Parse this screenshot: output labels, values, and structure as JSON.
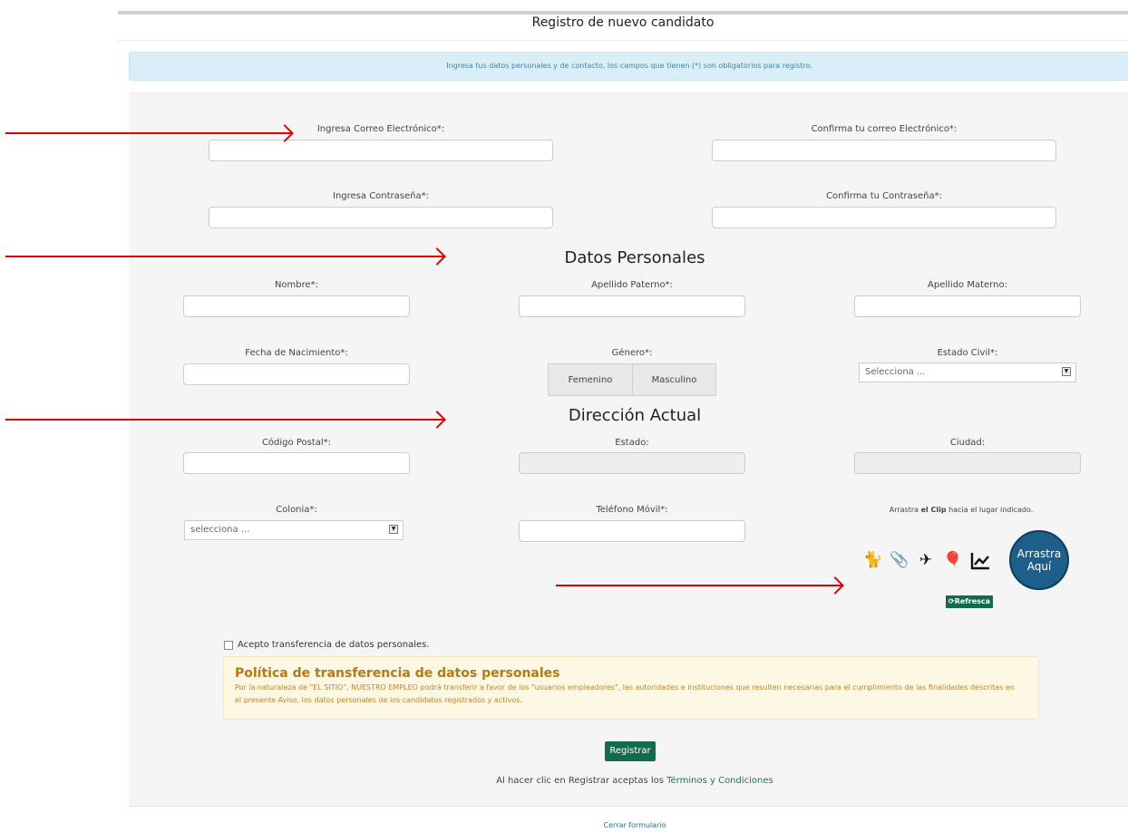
{
  "header": {
    "title": "Registro de nuevo candidato"
  },
  "notice": {
    "text": "Ingresa tus datos personales y de contacto, los campos que tienen (*) son obligatorios para registro."
  },
  "account": {
    "email_label": "Ingresa Correo Electrónico*:",
    "email_confirm_label": "Confirma tu correo Electrónico*:",
    "password_label": "Ingresa Contraseña*:",
    "password_confirm_label": "Confirma tu Contraseña*:"
  },
  "personal": {
    "heading": "Datos Personales",
    "nombre_label": "Nombre*:",
    "apellido_paterno_label": "Apellido Paterno*:",
    "apellido_materno_label": "Apellido Materno:",
    "fecha_label": "Fecha de Nacimiento*:",
    "genero_label": "Género*:",
    "genero_options": [
      "Femenino",
      "Masculino"
    ],
    "estado_civil_label": "Estado Civil*:",
    "estado_civil_value": "Selecciona ..."
  },
  "address": {
    "heading": "Dirección Actual",
    "cp_label": "Código Postal*:",
    "estado_label": "Estado:",
    "ciudad_label": "Ciudad:",
    "colonia_label": "Colonia*:",
    "colonia_value": "selecciona ...",
    "telefono_label": "Teléfono Móvil*:"
  },
  "captcha": {
    "instruction_pre": "Arrastra ",
    "instruction_bold": "el Clip",
    "instruction_post": " hacia el lugar indicado.",
    "icons": [
      "cat-icon",
      "paperclip-icon",
      "airplane-icon",
      "balloon-icon",
      "chart-icon"
    ],
    "target_line1": "Arrastra",
    "target_line2": "Aquí",
    "refresh_label": "Refresca"
  },
  "consent": {
    "checkbox_label": "Acepto transferencia de datos personales."
  },
  "policy": {
    "title": "Política de transferencia de datos personales",
    "text": "Por la naturaleza de \"EL SITIO\", NUESTRO EMPLEO podrá transferir a favor de los \"usuarios empleadores\", las autoridades e instituciones que resulten necesarias para el cumplimiento de las finalidades descritas en el presente Aviso, los datos personales de los candidatos registrados y activos."
  },
  "actions": {
    "register_label": "Registrar",
    "terms_pre": "Al hacer clic en Registrar aceptas los ",
    "terms_link": "Términos y Condiciones",
    "close_label": "Cerrar formulario"
  },
  "colors": {
    "accent": "#136b4d",
    "annotation_arrow": "#e00000",
    "notice_bg": "#d9eef8",
    "policy_bg": "#fcf8e3"
  }
}
